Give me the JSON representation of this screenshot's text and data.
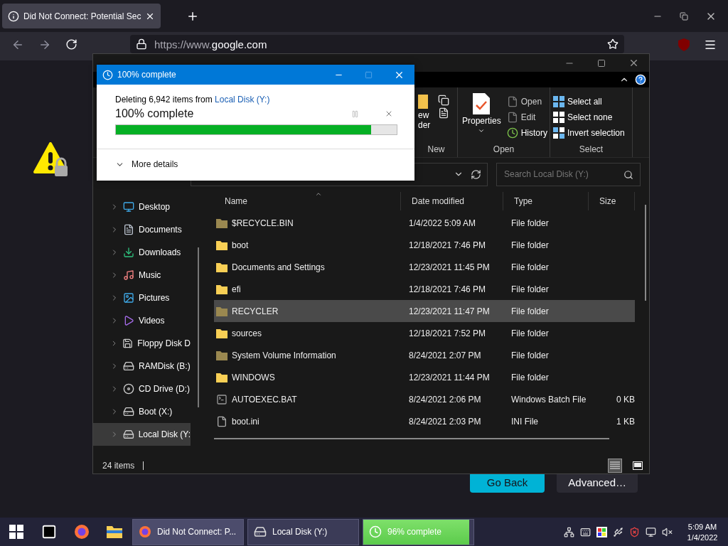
{
  "browser": {
    "tab": {
      "title": "Did Not Connect: Potential Sec"
    },
    "url": {
      "prefix": "https://www.",
      "domain": "google.com"
    },
    "buttons": [
      {
        "label": "Go Back",
        "kind": "primary"
      },
      {
        "label": "Advanced…",
        "kind": "secondary"
      }
    ]
  },
  "explorer": {
    "ribbon": {
      "new_group": {
        "label": "New",
        "folder_label": [
          "ew",
          "der"
        ]
      },
      "open_group": {
        "label": "Open",
        "properties": "Properties",
        "items": [
          "Open",
          "Edit",
          "History"
        ]
      },
      "select_group": {
        "label": "Select",
        "items": [
          "Select all",
          "Select none",
          "Invert selection"
        ]
      }
    },
    "search": {
      "placeholder": "Search Local Disk (Y:)"
    },
    "nav": [
      {
        "label": "Desktop",
        "kind": "desktop",
        "selected": false
      },
      {
        "label": "Documents",
        "kind": "documents",
        "selected": false
      },
      {
        "label": "Downloads",
        "kind": "downloads",
        "selected": false
      },
      {
        "label": "Music",
        "kind": "music",
        "selected": false
      },
      {
        "label": "Pictures",
        "kind": "pictures",
        "selected": false
      },
      {
        "label": "Videos",
        "kind": "videos",
        "selected": false
      },
      {
        "label": "Floppy Disk D",
        "kind": "floppy",
        "selected": false
      },
      {
        "label": "RAMDisk (B:)",
        "kind": "drive",
        "selected": false
      },
      {
        "label": "CD Drive (D:)",
        "kind": "cd",
        "selected": false
      },
      {
        "label": "Boot (X:)",
        "kind": "drive",
        "selected": false
      },
      {
        "label": "Local Disk (Y:",
        "kind": "drive",
        "selected": true
      }
    ],
    "columns": [
      "Name",
      "Date modified",
      "Type",
      "Size"
    ],
    "rows": [
      {
        "name": "$RECYCLE.BIN",
        "date": "1/4/2022 5:09 AM",
        "type": "File folder",
        "kind": "system-folder",
        "selected": false
      },
      {
        "name": "boot",
        "date": "12/18/2021 7:46 PM",
        "type": "File folder",
        "kind": "folder",
        "selected": false
      },
      {
        "name": "Documents and Settings",
        "date": "12/23/2021 11:45 PM",
        "type": "File folder",
        "kind": "folder",
        "selected": false
      },
      {
        "name": "efi",
        "date": "12/18/2021 7:46 PM",
        "type": "File folder",
        "kind": "folder",
        "selected": false
      },
      {
        "name": "RECYCLER",
        "date": "12/23/2021 11:47 PM",
        "type": "File folder",
        "kind": "system-folder",
        "selected": true
      },
      {
        "name": "sources",
        "date": "12/18/2021 7:52 PM",
        "type": "File folder",
        "kind": "folder",
        "selected": false
      },
      {
        "name": "System Volume Information",
        "date": "8/24/2021 2:07 PM",
        "type": "File folder",
        "kind": "system-folder",
        "selected": false
      },
      {
        "name": "WINDOWS",
        "date": "12/23/2021 11:44 PM",
        "type": "File folder",
        "kind": "folder",
        "selected": false
      },
      {
        "name": "AUTOEXEC.BAT",
        "date": "8/24/2021 2:06 PM",
        "type": "Windows Batch File",
        "size": "0 KB",
        "kind": "batch",
        "selected": false
      },
      {
        "name": "boot.ini",
        "date": "8/24/2021 2:03 PM",
        "type": "INI File",
        "size": "1 KB",
        "kind": "file",
        "selected": false
      }
    ],
    "status": "24 items"
  },
  "dialog": {
    "title": "100% complete",
    "message": "Deleting 6,942 items from ",
    "source": "Local Disk (Y:)",
    "status": "100% complete",
    "level": 0.91,
    "more": "More details"
  },
  "taskbar": {
    "tasks": [
      {
        "label": "Did Not Connect: P...",
        "kind": "browser",
        "selected": true
      },
      {
        "label": "Local Disk (Y:)",
        "kind": "drive",
        "selected": false
      },
      {
        "label": "96% complete",
        "kind": "progress",
        "selected": false,
        "level": 0.96
      }
    ],
    "time": "5:09 AM",
    "date": "1/4/2022"
  }
}
